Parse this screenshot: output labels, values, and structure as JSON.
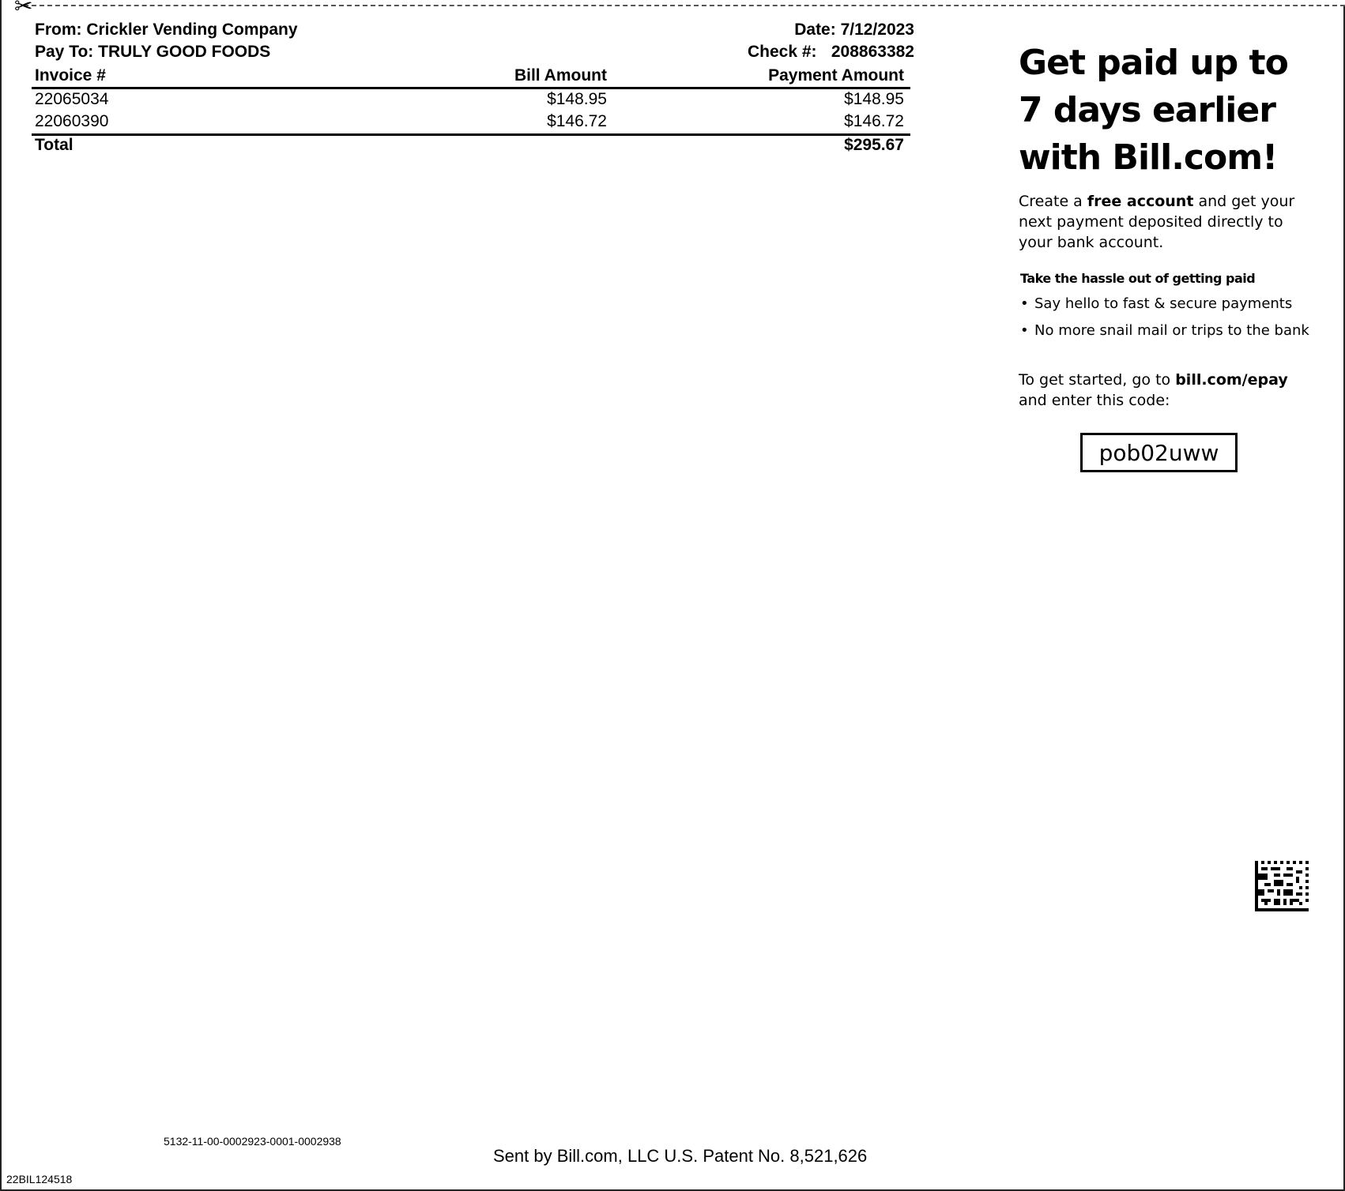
{
  "remittance": {
    "from": "From: Crickler Vending Company",
    "pay_to": "Pay To: TRULY GOOD FOODS",
    "date": "Date: 7/12/2023",
    "check_label": "Check #:",
    "check_number": "208863382",
    "columns": [
      "Invoice #",
      "Bill Amount",
      "Payment Amount"
    ],
    "rows": [
      {
        "invoice": "22065034",
        "bill": "$148.95",
        "payment": "$148.95"
      },
      {
        "invoice": "22060390",
        "bill": "$146.72",
        "payment": "$146.72"
      }
    ],
    "total_label": "Total",
    "total_amount": "$295.67"
  },
  "promo": {
    "headline": [
      "Get paid up to",
      "7 days earlier",
      "with Bill.com!"
    ],
    "intro_pre": "Create a ",
    "intro_bold": "free account",
    "intro_post_line1": " and get your",
    "intro_line2": "next payment deposited directly to",
    "intro_line3": "your bank account.",
    "subhead": "Take the hassle out of getting paid",
    "bullets": [
      "Say hello to fast & secure payments",
      "No more snail mail or trips to the bank"
    ],
    "started_pre": "To get started, go to ",
    "started_link": "bill.com/epay",
    "started_line2": "and enter this code:",
    "code": "pob02uww"
  },
  "footer": {
    "tracking": "5132-11-00-0002923-0001-0002938",
    "sent_by": "Sent by Bill.com, LLC  U.S. Patent No. 8,521,626",
    "doc_id": "22BIL124518"
  },
  "icons": {
    "scissors": "scissors-icon",
    "datamatrix": "datamatrix-barcode-icon"
  }
}
